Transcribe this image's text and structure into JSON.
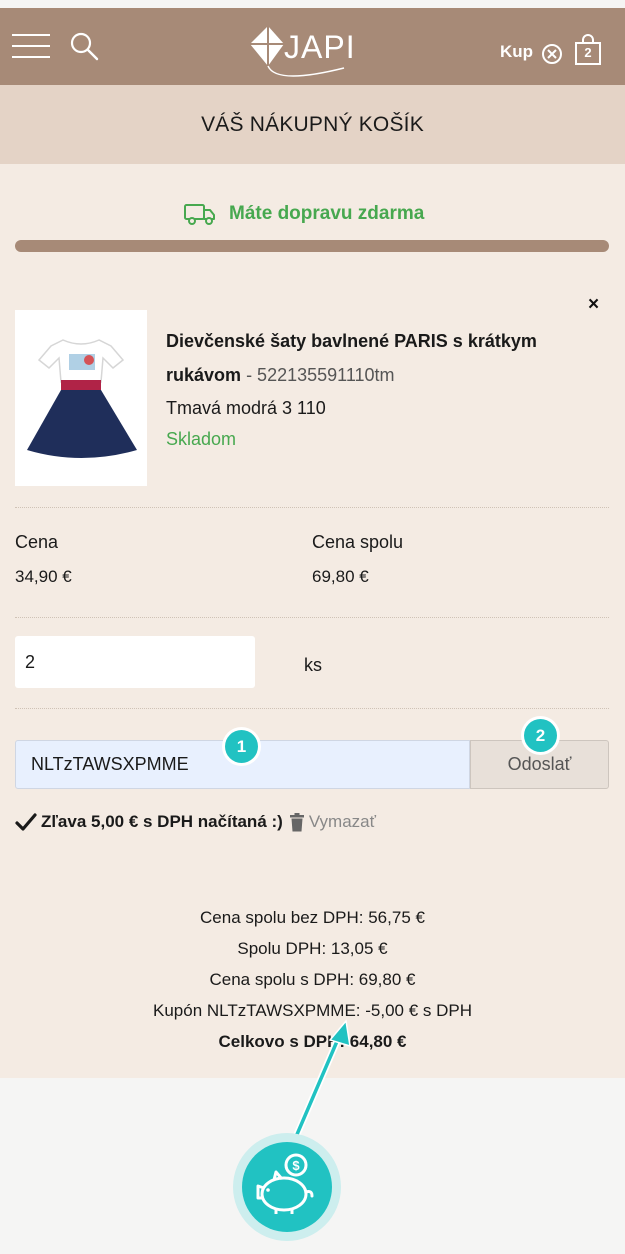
{
  "header": {
    "cart_label": "Kup",
    "cart_count": "2",
    "logo_text": "JAPI"
  },
  "page_title": "VÁŠ NÁKUPNÝ KOŠÍK",
  "shipping": {
    "message": "Máte dopravu zdarma",
    "progress": 1.0
  },
  "product": {
    "name": "Dievčenské šaty bavlnené PARIS s krátkym rukávom",
    "sku": "- 522135591110tm",
    "variant": "Tmavá modrá 3 110",
    "stock": "Skladom",
    "remove_label": "×"
  },
  "pricing": {
    "price_label": "Cena",
    "price_value": "34,90 €",
    "total_label": "Cena spolu",
    "total_value": "69,80 €"
  },
  "quantity": {
    "value": "2",
    "unit": "ks"
  },
  "coupon": {
    "code": "NLTzTAWSXPMME",
    "submit_label": "Odoslať",
    "badge_1": "1",
    "badge_2": "2",
    "applied_message": "Zľava 5,00  € s DPH načítaná :)",
    "delete_label": "Vymazať"
  },
  "totals": {
    "without_vat": "Cena spolu bez DPH: 56,75 €",
    "vat": "Spolu DPH: 13,05 €",
    "with_vat": "Cena spolu s DPH: 69,80 €",
    "coupon_line": "Kupón NLTzTAWSXPMME: -5,00  € s DPH",
    "grand_total": "Celkovo s DPH: 64,80 €"
  },
  "colors": {
    "header": "#a78a77",
    "title_bar": "#e4d3c6",
    "content_bg": "#f4ebe3",
    "success_green": "#47a84f",
    "accent_teal": "#21c2c2"
  }
}
